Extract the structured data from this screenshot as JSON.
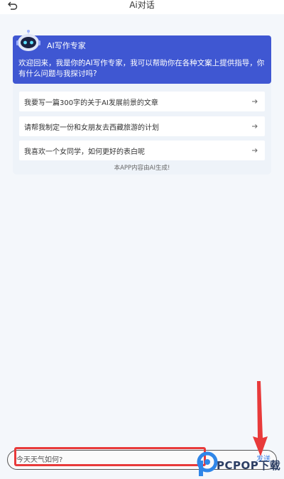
{
  "header": {
    "title": "Ai对话",
    "back_icon": "back-arrow-icon"
  },
  "expert_card": {
    "avatar_icon": "robot-icon",
    "title": "AI写作专家",
    "welcome": "欢迎回来，我是你的AI写作专家，我可以帮助你在各种文案上提供指导，你有什么问题与我探讨吗?",
    "suggestions": [
      {
        "label": "我要写一篇300字的关于AI发展前景的文章",
        "icon": "arrow-right-icon"
      },
      {
        "label": "请帮我制定一份和女朋友去西藏旅游的计划",
        "icon": "arrow-right-icon"
      },
      {
        "label": "我喜欢一个女同学，如何更好的表白呢",
        "icon": "arrow-right-icon"
      }
    ],
    "disclaimer": "本APP内容由AI生成!"
  },
  "composer": {
    "placeholder": "今天天气如何?",
    "send_label": "发送"
  },
  "watermark": {
    "text": "PCPOP下载"
  },
  "colors": {
    "card_header": "#3f57d2",
    "highlight": "#e83a3a",
    "send": "#3a7fe6",
    "background": "#f4f7fb"
  }
}
